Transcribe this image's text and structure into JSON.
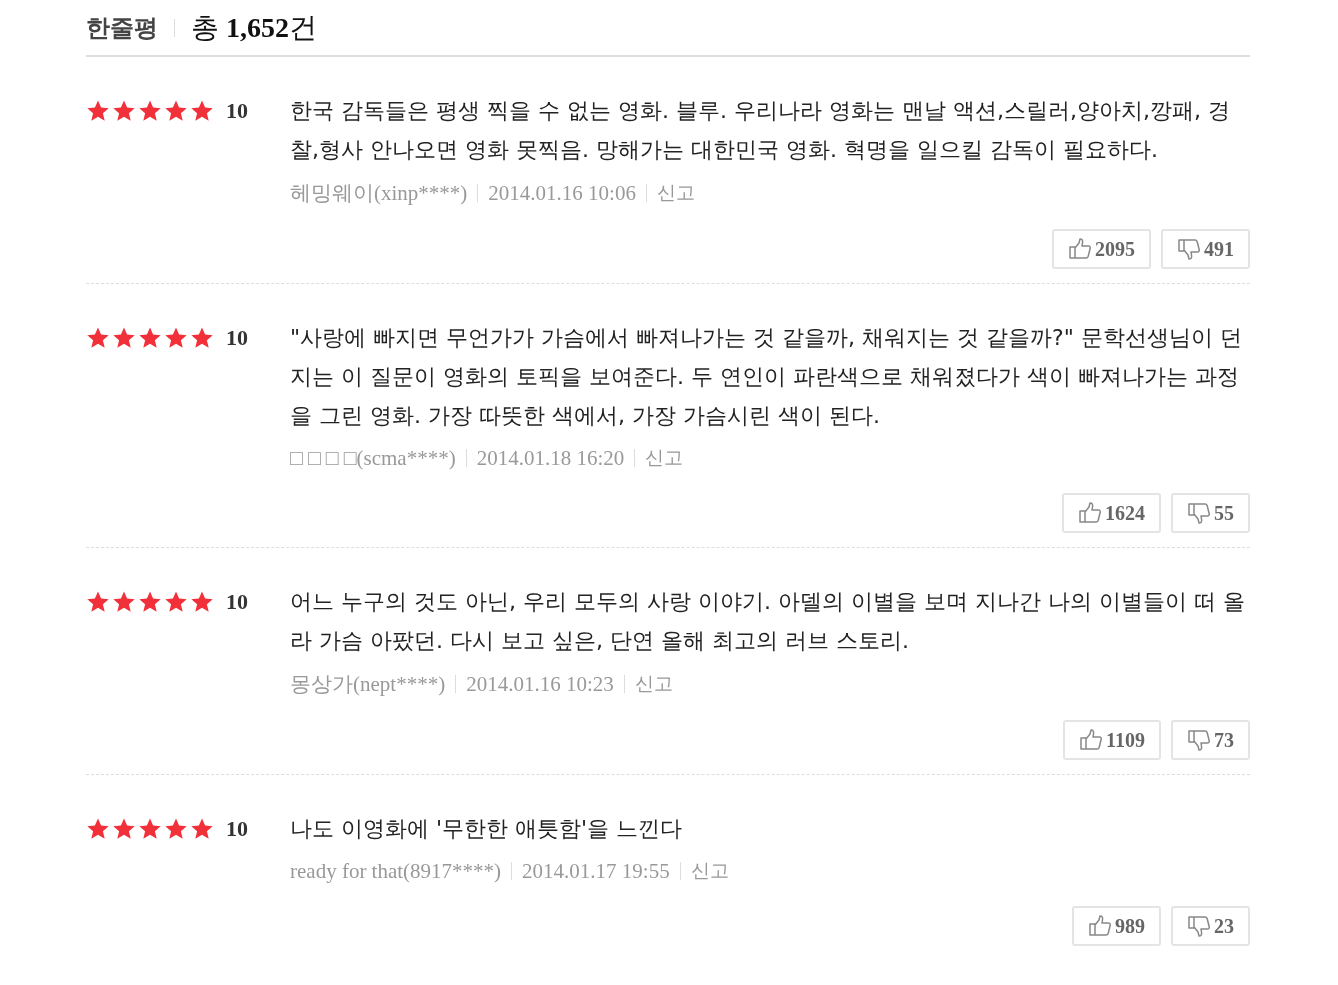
{
  "header": {
    "title": "한줄평",
    "total": "총 **1,652**건"
  },
  "reviews": [
    {
      "stars": 5,
      "score": "10",
      "text": "한국 감독들은 평생 찍을 수 없는 영화. 블루. 우리나라 영화는 맨날 액션,스릴러,양아치,깡패, 경찰,형사 안나오면 영화 못찍음. 망해가는 대한민국 영화. 혁명을 일으킬 감독이 필요하다.",
      "author": "헤밍웨이(xinp****)",
      "date": "2014.01.16 10:06",
      "report": "신고",
      "likes": "2095",
      "dislikes": "491"
    },
    {
      "stars": 5,
      "score": "10",
      "text": "\"사랑에 빠지면 무언가가 가슴에서 빠져나가는 것 같을까, 채워지는 것 같을까?\" 문학선생님이 던지는 이 질문이 영화의 토픽을 보여준다. 두 연인이 파란색으로 채워졌다가 색이 빠져나가는 과정을 그린 영화. 가장 따뜻한 색에서, 가장 가슴시린 색이 된다.",
      "author": "□ □ □ □(scma****)",
      "date": "2014.01.18 16:20",
      "report": "신고",
      "likes": "1624",
      "dislikes": "55"
    },
    {
      "stars": 5,
      "score": "10",
      "text": "어느 누구의 것도 아닌, 우리 모두의 사랑 이야기. 아델의 이별을 보며 지나간 나의 이별들이 떠 올라 가슴 아팠던. 다시 보고 싶은, 단연 올해 최고의 러브 스토리.",
      "author": "몽상가(nept****)",
      "date": "2014.01.16 10:23",
      "report": "신고",
      "likes": "1109",
      "dislikes": "73"
    },
    {
      "stars": 5,
      "score": "10",
      "text": "나도 이영화에 '무한한 애틋함'을 느낀다",
      "author": "ready for that(8917****)",
      "date": "2014.01.17 19:55",
      "report": "신고",
      "likes": "989",
      "dislikes": "23"
    }
  ]
}
